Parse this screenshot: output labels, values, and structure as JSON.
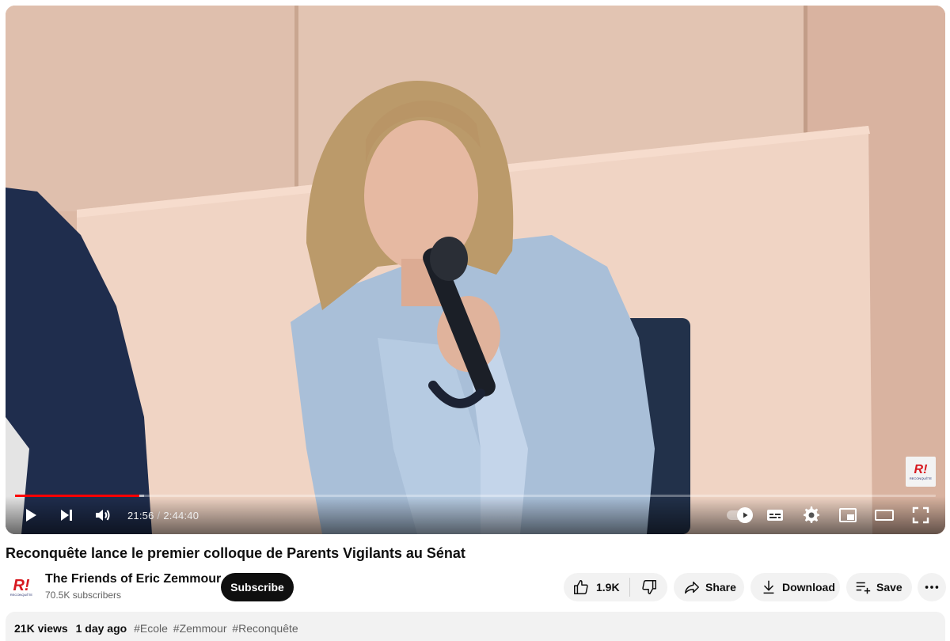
{
  "player": {
    "current_time": "21:56",
    "separator": "/",
    "duration": "2:44:40",
    "progress_fraction": 0.135,
    "buffered_fraction": 0.14,
    "watermark_logo": "R!",
    "watermark_caption": "RECONQUÊTE",
    "colors": {
      "played": "#ff0000",
      "control_icons": "#ffffff"
    },
    "icons": [
      "play-icon",
      "next-icon",
      "volume-icon",
      "autoplay-toggle-icon",
      "subtitles-icon",
      "settings-gear-icon",
      "miniplayer-icon",
      "theater-mode-icon",
      "fullscreen-icon"
    ]
  },
  "video": {
    "title": "Reconquête lance le premier colloque de Parents Vigilants au Sénat"
  },
  "channel": {
    "avatar_logo": "R!",
    "avatar_caption": "RECONQUÊTE",
    "name": "The Friends of Eric Zemmour",
    "subscribers": "70.5K subscribers",
    "subscribe_label": "Subscribe"
  },
  "actions": {
    "likes": "1.9K",
    "share_label": "Share",
    "download_label": "Download",
    "save_label": "Save"
  },
  "description": {
    "views": "21K views",
    "age": "1 day ago",
    "tags": [
      "#Ecole",
      "#Zemmour",
      "#Reconquête"
    ]
  }
}
